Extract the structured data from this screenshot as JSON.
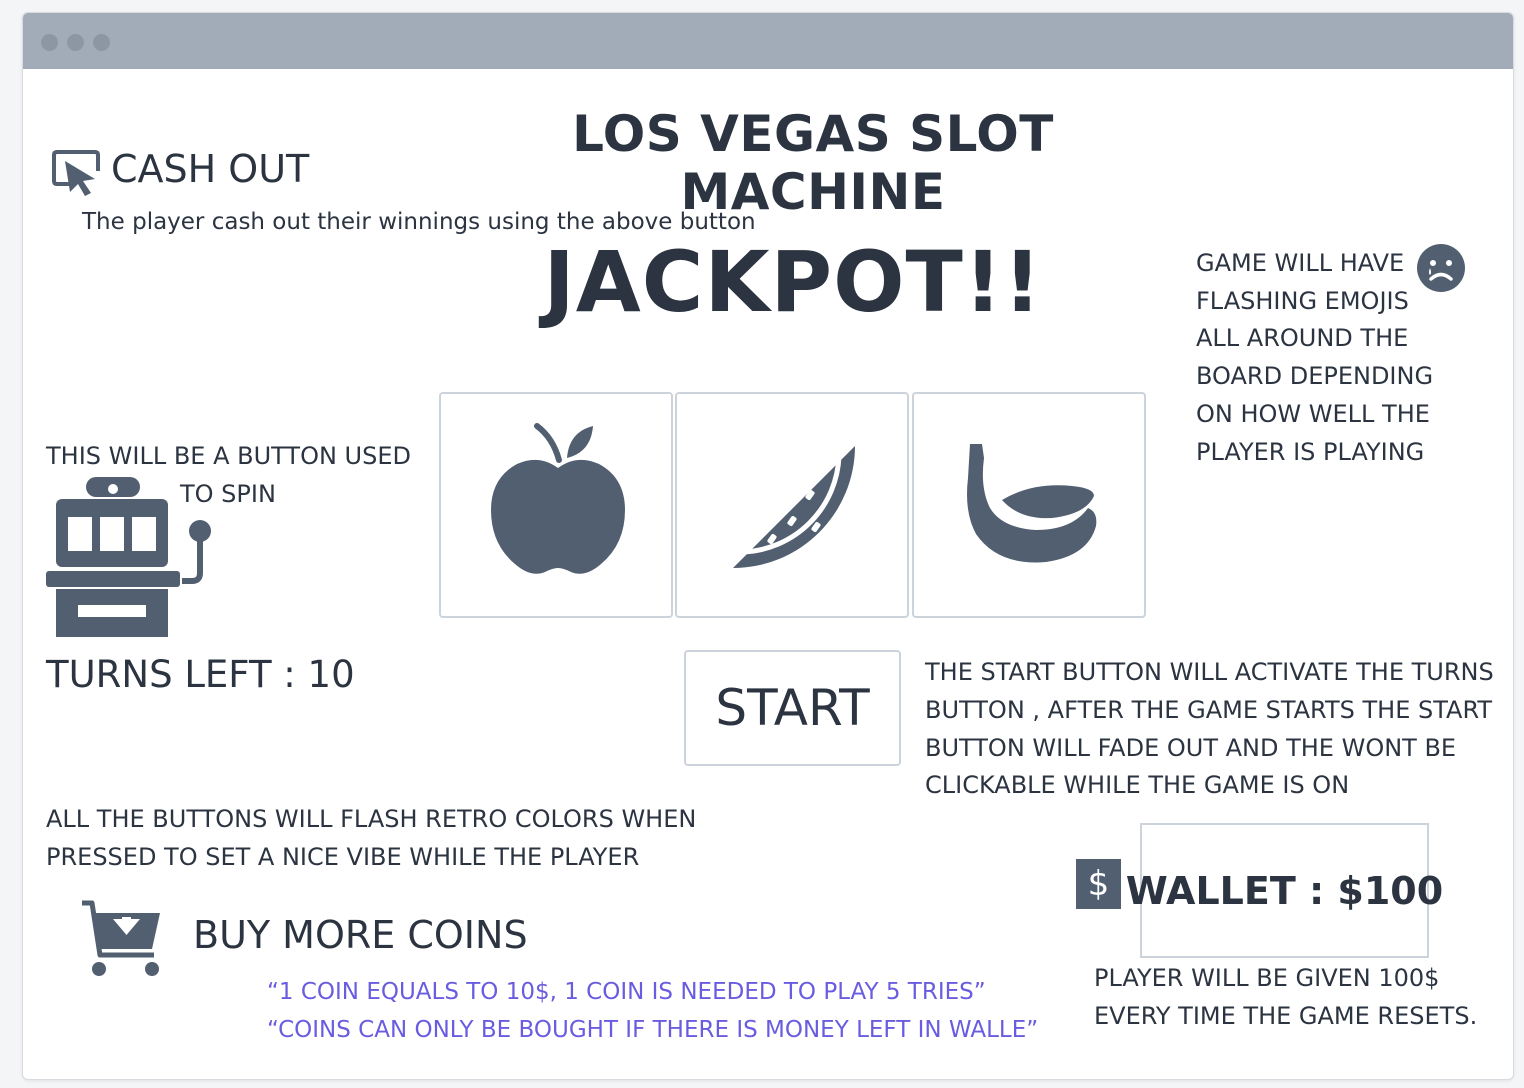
{
  "window": {
    "titlebar_color": "#a1acb8"
  },
  "header": {
    "title": "LOS VEGAS SLOT MACHINE"
  },
  "cashout": {
    "label": "CASH OUT",
    "icon": "cursor-click-icon",
    "note": "The player cash out their winnings using the above button"
  },
  "jackpot": {
    "text": "JACKPOT!!"
  },
  "emoji_note": {
    "text": "GAME WILL HAVE FLASHING EMOJIS ALL AROUND THE BOARD DEPENDING ON HOW WELL THE PLAYER IS PLAYING",
    "icon": "sad-face-icon"
  },
  "spin": {
    "note_line1": "THIS WILL BE A BUTTON USED",
    "note_line2": "TO SPIN",
    "icon": "slot-machine-icon"
  },
  "reels": [
    {
      "icon": "apple-icon"
    },
    {
      "icon": "watermelon-slice-icon"
    },
    {
      "icon": "banana-icon"
    }
  ],
  "turns": {
    "label": "TURNS LEFT : 10"
  },
  "start": {
    "label": "START",
    "note": "THE  START BUTTON WILL ACTIVATE THE TURNS BUTTON , AFTER THE GAME STARTS THE START BUTTON WILL FADE OUT AND THE WONT BE CLICKABLE WHILE THE GAME IS ON"
  },
  "flash_note": {
    "text": "ALL THE BUTTONS WILL FLASH RETRO COLORS WHEN PRESSED TO SET A NICE VIBE WHILE THE PLAYER"
  },
  "buy": {
    "label": "BUY MORE COINS",
    "icon": "shopping-cart-icon",
    "quote_line1": "“1 COIN EQUALS TO 10$, 1 COIN IS NEEDED TO PLAY 5 TRIES”",
    "quote_line2": "“COINS CAN ONLY BE BOUGHT IF THERE IS MONEY LEFT IN WALLE”"
  },
  "wallet": {
    "label": "WALLET : $100",
    "icon": "dollar-icon",
    "icon_text": "$",
    "note": "PLAYER WILL BE GIVEN 100$ EVERY TIME THE GAME RESETS."
  },
  "colors": {
    "icon": "#525f70",
    "text": "#2b3440",
    "accent": "#6a5ce0"
  }
}
